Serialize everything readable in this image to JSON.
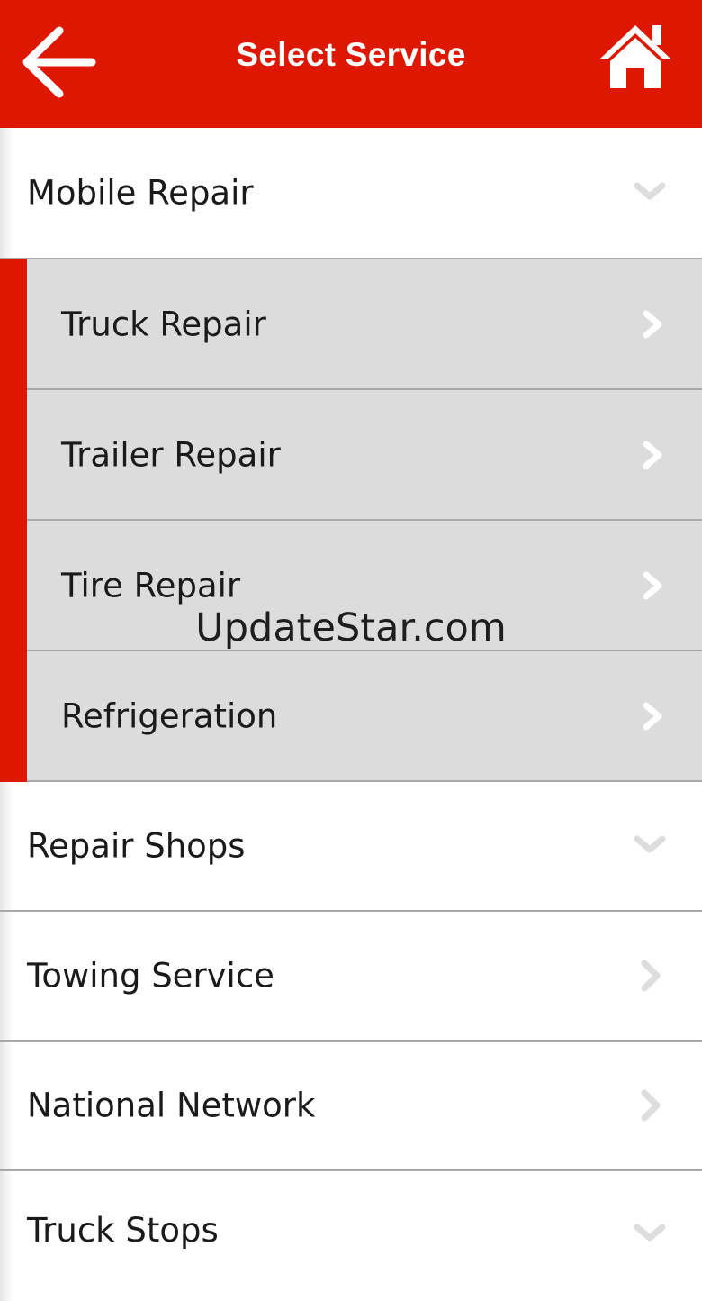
{
  "header": {
    "title": "Select Service",
    "back_icon": "arrow-left-icon",
    "home_icon": "home-icon",
    "bg_color": "#dd1700"
  },
  "menu": {
    "mobile_repair": {
      "label": "Mobile Repair",
      "state": "expanded"
    },
    "sub_items": [
      {
        "label": "Truck Repair"
      },
      {
        "label": "Trailer Repair"
      },
      {
        "label": "Tire Repair"
      },
      {
        "label": "Refrigeration"
      }
    ],
    "repair_shops": {
      "label": "Repair Shops"
    },
    "towing_service": {
      "label": "Towing Service"
    },
    "national_network": {
      "label": "National Network"
    },
    "truck_stops": {
      "label": "Truck Stops"
    }
  },
  "watermark": "UpdateStar.com",
  "colors": {
    "accent": "#dd1700",
    "sub_bg": "#dcdcdc",
    "divider": "#a9a9a9"
  }
}
